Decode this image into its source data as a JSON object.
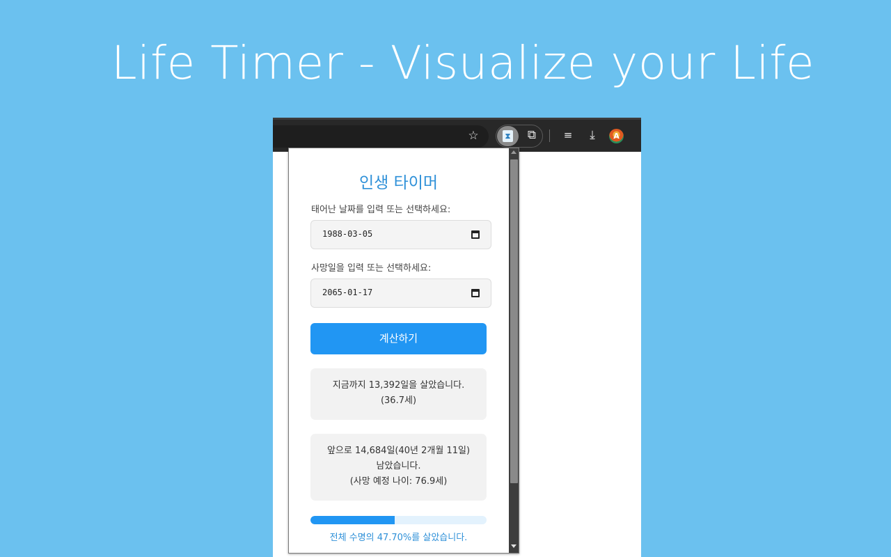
{
  "headline": "Life Timer - Visualize your Life",
  "browser": {
    "icons": [
      "star-icon",
      "hourglass-extension-icon",
      "puzzle-extensions-icon",
      "media-controls-icon",
      "download-icon",
      "profile-avatar",
      "more-menu-icon"
    ]
  },
  "popup": {
    "title": "인생 타이머",
    "birth_label": "태어난 날짜를 입력 또는 선택하세요:",
    "birth_value": "1988-03-05",
    "death_label": "사망일을 입력 또는 선택하세요:",
    "death_value": "2065-01-17",
    "calculate_label": "계산하기",
    "lived_line1": "지금까지 13,392일을 살았습니다.",
    "lived_line2": "(36.7세)",
    "remaining_line1": "앞으로 14,684일(40년 2개월 11일)",
    "remaining_line2": "남았습니다.",
    "remaining_line3": "(사망 예정 나이: 76.9세)",
    "progress_fraction": 0.477,
    "progress_text": "전체 수명의 47.70%를 살았습니다."
  },
  "colors": {
    "background": "#6bc1ef",
    "accent": "#2196f3",
    "title": "#2e90d8"
  }
}
